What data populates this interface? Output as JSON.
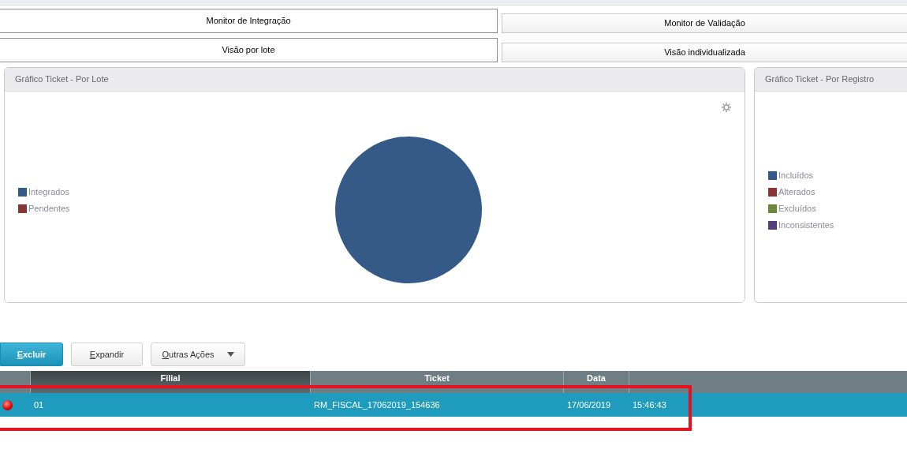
{
  "tab_rows": [
    [
      {
        "label": "Monitor de Integração",
        "selected": true
      },
      {
        "label": "Monitor de Validação",
        "selected": false
      }
    ],
    [
      {
        "label": "Visão por lote",
        "selected": true
      },
      {
        "label": "Visão individualizada",
        "selected": false
      }
    ]
  ],
  "panels": [
    {
      "title": "Gráfico Ticket - Por Lote",
      "has_pie": true,
      "has_settings": true,
      "legend": [
        {
          "label": "Integrados",
          "color": "#365a87"
        },
        {
          "label": "Pendentes",
          "color": "#883636"
        }
      ]
    },
    {
      "title": "Gráfico Ticket - Por Registro",
      "has_pie": false,
      "has_settings": false,
      "legend": [
        {
          "label": "Incluídos",
          "color": "#365a87"
        },
        {
          "label": "Alterados",
          "color": "#883636"
        },
        {
          "label": "Excluídos",
          "color": "#6a883a"
        },
        {
          "label": "Inconsistentes",
          "color": "#553f78"
        }
      ]
    }
  ],
  "buttons": [
    {
      "label": "Excluir",
      "kind": "primary"
    },
    {
      "label": "Expandir",
      "kind": "default"
    },
    {
      "label": "Outras Ações",
      "kind": "dropdown"
    }
  ],
  "table": {
    "columns": [
      "Filial",
      "Ticket",
      "Data"
    ],
    "rows": [
      {
        "selected": true,
        "cells": [
          "01",
          "RM_FISCAL_17062019_154636",
          "17/06/2019",
          "15:46:43"
        ]
      }
    ]
  },
  "annotation": {
    "shown": true
  }
}
